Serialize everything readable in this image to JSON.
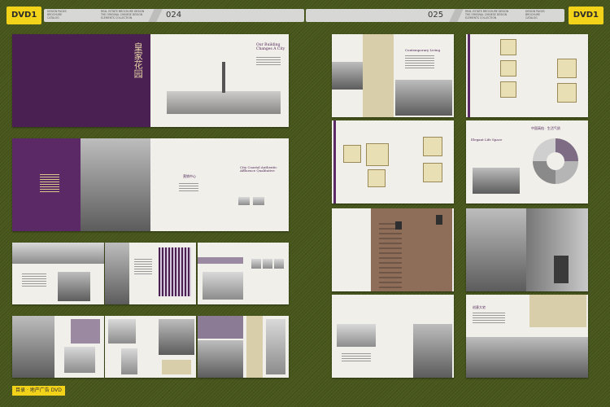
{
  "header": {
    "left_badge": "DVD1",
    "right_badge": "DVD1",
    "left_page_number": "024",
    "right_page_number": "025",
    "left_small_a": "DESIGN PAGES\nBROCHURE\nCATALOG",
    "left_small_b": "REAL ESTATE BROCHURE DESIGN\nTHE ORIGINAL CHINESE DESIGN\nELEMENTS COLLECTION",
    "right_small_a": "REAL ESTATE BROCHURE DESIGN\nTHE ORIGINAL CHINESE DESIGN\nELEMENTS COLLECTION",
    "right_small_b": "DESIGN PAGES\nBROCHURE\nCATALOG"
  },
  "spreads": {
    "s1_vertical_title": "皇家花园",
    "s1_right_heading": "Our Building\nChanges A City",
    "s2_heading": "City Coastal Authentic\nAffluence Qualitative",
    "s2_label": "营销中心",
    "r1_heading": "Contemporary Living",
    "r3_heading": "Elegant Life Space",
    "r_last_heading": "创意大宅",
    "chinese_caption": "中国高档 · 生活气质"
  },
  "footer": {
    "label": "目录 · 地产广告 DVD"
  },
  "colors": {
    "background": "#4b5a1f",
    "badge": "#f3d21a",
    "accent_purple": "#4a1f52",
    "page": "#f1efea"
  }
}
